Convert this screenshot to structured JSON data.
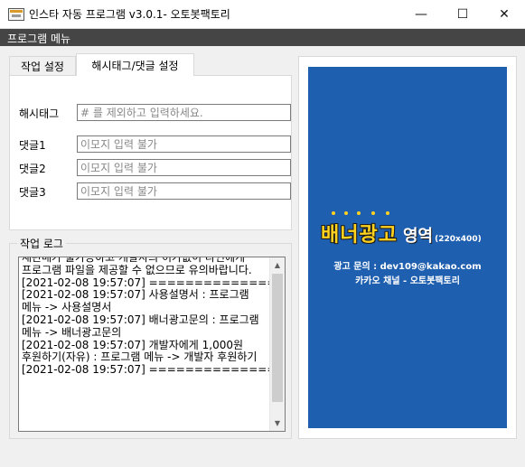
{
  "window": {
    "title": "인스타 자동 프로그램 v3.0.1- 오토봇팩토리",
    "minimize_glyph": "—",
    "maximize_glyph": "☐",
    "close_glyph": "✕",
    "app_icon": "app-window-icon"
  },
  "menu": {
    "program_menu": "프로그램 메뉴"
  },
  "tabs": [
    {
      "label": "작업 설정",
      "active": false
    },
    {
      "label": "해시태그/댓글 설정",
      "active": true
    }
  ],
  "settings": {
    "hashtag_label": "해시태그",
    "hashtag_placeholder": "# 를 제외하고 입력하세요.",
    "comment1_label": "댓글1",
    "comment1_placeholder": "이모지 입력 불가",
    "comment2_label": "댓글2",
    "comment2_placeholder": "이모지 입력 불가",
    "comment3_label": "댓글3",
    "comment3_placeholder": "이모지 입력 불가"
  },
  "log": {
    "title": "작업 로그",
    "lines": [
      "재판매가 불가능하고 개발자의 허가없이 타인에게 프로그램 파일을 제공할 수 없으므로 유의바랍니다.",
      "[2021-02-08 19:57:07]  ====================",
      "[2021-02-08 19:57:07] 사용설명서 : 프로그램 메뉴 -> 사용설명서",
      "[2021-02-08 19:57:07] 배너광고문의 : 프로그램 메뉴 -> 배너광고문의",
      "[2021-02-08 19:57:07] 개발자에게 1,000원 후원하기(자유) : 프로그램 메뉴 -> 개발자 후원하기",
      "[2021-02-08 19:57:07]  ===================="
    ]
  },
  "banner": {
    "title_yellow": "배너광고",
    "title_white": "영역",
    "size_text": "(220x400)",
    "contact": "광고 문의 : dev109@kakao.com",
    "channel": "카카오 채널 - 오토봇팩토리",
    "bg_color": "#1f5fb0",
    "accent_color": "#ffd21f"
  }
}
